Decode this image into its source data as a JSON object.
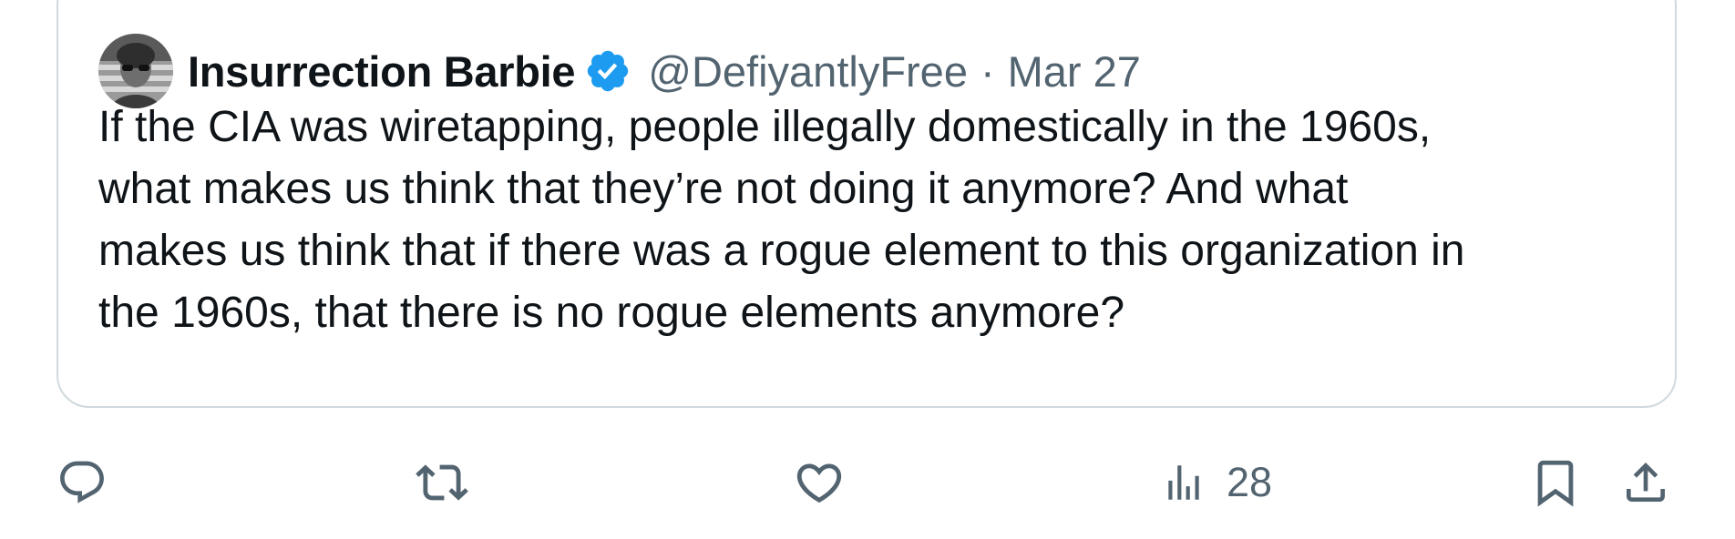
{
  "quoted_tweet": {
    "author": {
      "display_name": "Insurrection Barbie",
      "handle": "@DefiyantlyFree",
      "verified": true
    },
    "separator": "·",
    "date": "Mar 27",
    "text": "If the CIA was wiretapping, people illegally domestically in the 1960s,\nwhat makes us think that they’re not doing it anymore? And what\nmakes us think that if there was a rogue element to this organization in\nthe 1960s, that there is no rogue elements anymore?"
  },
  "actions": {
    "reply": {
      "icon": "reply-icon"
    },
    "repost": {
      "icon": "repost-icon"
    },
    "like": {
      "icon": "heart-icon"
    },
    "views": {
      "icon": "views-icon",
      "count": "28"
    },
    "bookmark": {
      "icon": "bookmark-icon"
    },
    "share": {
      "icon": "share-icon"
    }
  },
  "colors": {
    "text_primary": "#0f1419",
    "text_secondary": "#536471",
    "border": "#cfd9de",
    "verified_blue": "#1d9bf0"
  }
}
